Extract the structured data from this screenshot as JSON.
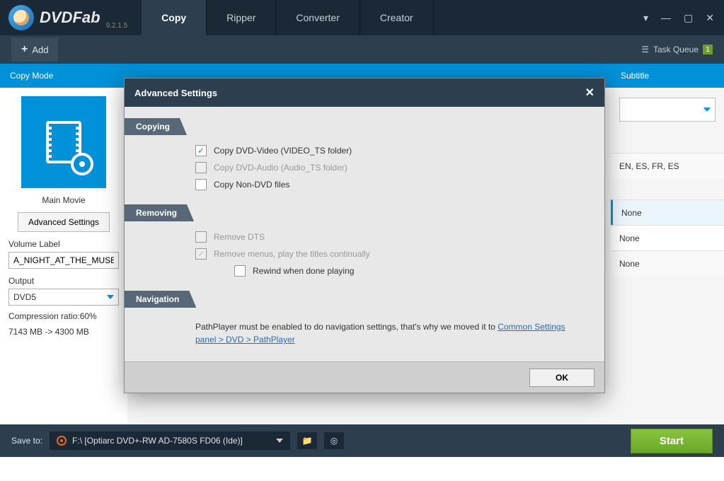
{
  "app": {
    "name": "DVDFab",
    "version": "9.2.1.5"
  },
  "tabs": {
    "copy": "Copy",
    "ripper": "Ripper",
    "converter": "Converter",
    "creator": "Creator"
  },
  "toolbar": {
    "add": "Add",
    "task_queue": "Task Queue",
    "queue_count": "1"
  },
  "header": {
    "copy_mode": "Copy Mode",
    "subtitle": "Subtitle"
  },
  "left": {
    "mode": "Main Movie",
    "adv_btn": "Advanced Settings",
    "vol_label": "Volume Label",
    "vol_value": "A_NIGHT_AT_THE_MUSEUM",
    "out_label": "Output",
    "out_value": "DVD5",
    "ratio_line": "Compression ratio:60%",
    "size_line": "7143 MB -> 4300 MB"
  },
  "subtitle": {
    "row1": "EN, ES, FR, ES",
    "row2": "None",
    "row3": "None",
    "row4": "None"
  },
  "modal": {
    "title": "Advanced Settings",
    "sec_copying": "Copying",
    "opt1": "Copy DVD-Video (VIDEO_TS folder)",
    "opt2": "Copy DVD-Audio (Audio_TS folder)",
    "opt3": "Copy Non-DVD files",
    "sec_removing": "Removing",
    "opt4": "Remove DTS",
    "opt5": "Remove menus, play the titles continually",
    "opt6": "Rewind when done playing",
    "sec_nav": "Navigation",
    "nav_text_pre": "PathPlayer must be enabled to do navigation settings, that's why we moved it to ",
    "nav_link": "Common Settings panel > DVD > PathPlayer",
    "ok": "OK"
  },
  "footer": {
    "save_label": "Save to:",
    "target": "F:\\ [Optiarc DVD+-RW AD-7580S FD06 (Ide)]",
    "start": "Start"
  }
}
